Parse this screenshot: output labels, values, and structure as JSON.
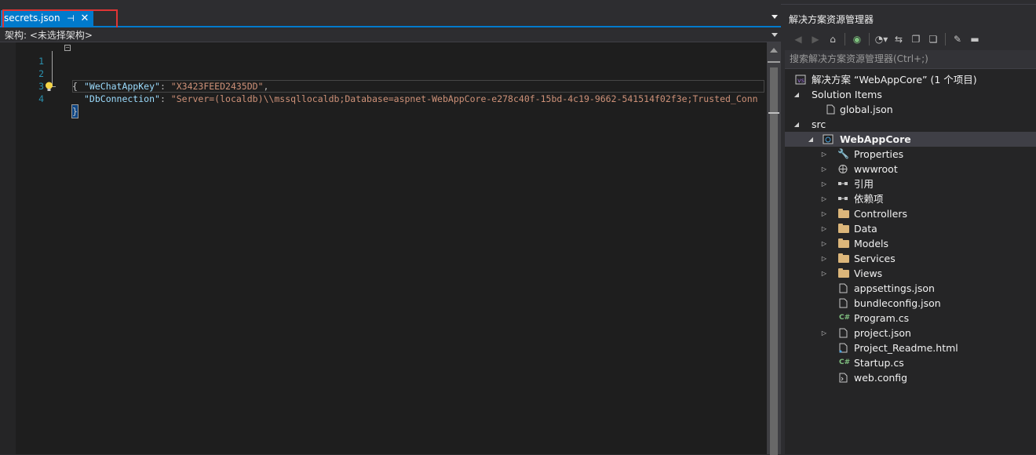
{
  "editor": {
    "tab": {
      "label": "secrets.json",
      "pin_glyph": "⊣",
      "close_glyph": "✕"
    },
    "navbar_text": "架构: <未选择架构>",
    "lines": [
      {
        "num": "1"
      },
      {
        "num": "2",
        "key": "\"WeChatAppKey\"",
        "sep": ": ",
        "val": "\"X3423FEED2435DD\"",
        "tail": ","
      },
      {
        "num": "3",
        "key": "\"DbConnection\"",
        "sep": ": ",
        "val": "\"Server=(localdb)\\\\mssqllocaldb;Database=aspnet-WebAppCore-e278c40f-15bd-4c19-9662-541514f02f3e;Trusted_Conn"
      },
      {
        "num": "4"
      }
    ],
    "open_brace": "{",
    "close_brace": "}"
  },
  "solution_explorer": {
    "title": "解决方案资源管理器",
    "search_placeholder": "搜索解决方案资源管理器(Ctrl+;)",
    "toolbar": [
      "back-icon",
      "forward-icon",
      "home-icon",
      "pending-changes-filter-icon",
      "history-icon",
      "sync-icon",
      "collapse-all-icon",
      "show-all-files-icon",
      "properties-icon",
      "preview-icon"
    ],
    "tree": [
      {
        "label": "解决方案 “WebAppCore” (1 个项目)",
        "icon": "solution-icon",
        "level": 0,
        "expander": ""
      },
      {
        "label": "Solution Items",
        "icon": "",
        "level": 1,
        "expander": "◢"
      },
      {
        "label": "global.json",
        "icon": "json-icon",
        "level": 2,
        "expander": ""
      },
      {
        "label": "src",
        "icon": "",
        "level": 1,
        "expander": "◢"
      },
      {
        "label": "WebAppCore",
        "icon": "web-project-icon",
        "level": 2,
        "expander": "◢",
        "selected": true
      },
      {
        "label": "Properties",
        "icon": "wrench-icon",
        "level": 3,
        "expander": "▷"
      },
      {
        "label": "wwwroot",
        "icon": "globe-icon",
        "level": 3,
        "expander": "▷"
      },
      {
        "label": "引用",
        "icon": "references-icon",
        "level": 3,
        "expander": "▷"
      },
      {
        "label": "依赖项",
        "icon": "dependencies-icon",
        "level": 3,
        "expander": "▷"
      },
      {
        "label": "Controllers",
        "icon": "folder-icon",
        "level": 3,
        "expander": "▷"
      },
      {
        "label": "Data",
        "icon": "folder-icon",
        "level": 3,
        "expander": "▷"
      },
      {
        "label": "Models",
        "icon": "folder-icon",
        "level": 3,
        "expander": "▷"
      },
      {
        "label": "Services",
        "icon": "folder-icon",
        "level": 3,
        "expander": "▷"
      },
      {
        "label": "Views",
        "icon": "folder-icon",
        "level": 3,
        "expander": "▷"
      },
      {
        "label": "appsettings.json",
        "icon": "json-icon",
        "level": 3,
        "expander": ""
      },
      {
        "label": "bundleconfig.json",
        "icon": "json-icon",
        "level": 3,
        "expander": ""
      },
      {
        "label": "Program.cs",
        "icon": "csharp-icon",
        "level": 3,
        "expander": ""
      },
      {
        "label": "project.json",
        "icon": "json-icon",
        "level": 3,
        "expander": "▷"
      },
      {
        "label": "Project_Readme.html",
        "icon": "html-icon",
        "level": 3,
        "expander": ""
      },
      {
        "label": "Startup.cs",
        "icon": "csharp-icon",
        "level": 3,
        "expander": ""
      },
      {
        "label": "web.config",
        "icon": "config-icon",
        "level": 3,
        "expander": ""
      }
    ]
  },
  "colors": {
    "accent": "#007acc",
    "highlight_box": "#e03535",
    "folder": "#dcb67a"
  }
}
